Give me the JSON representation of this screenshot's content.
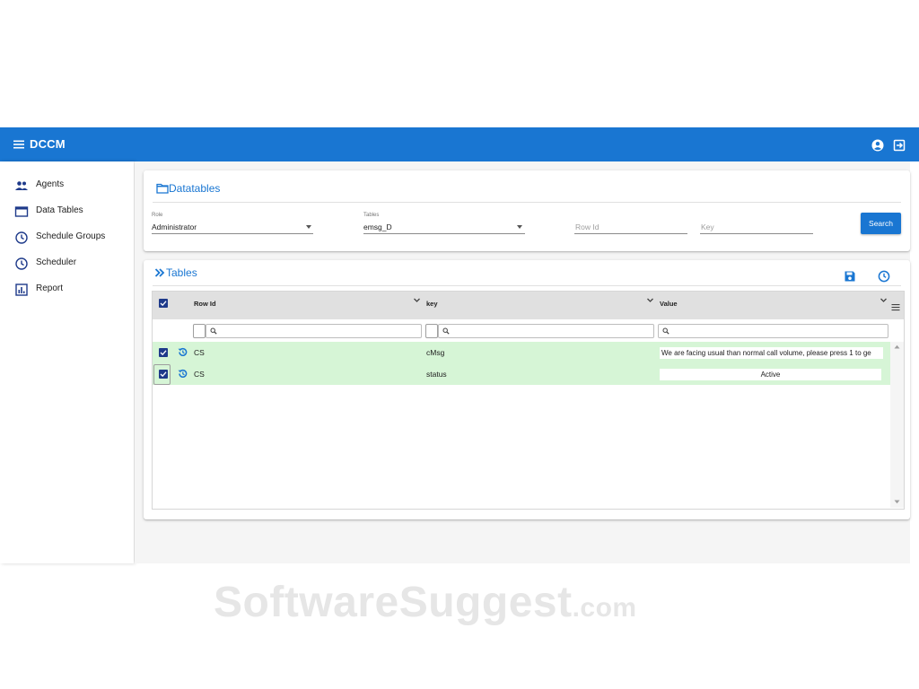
{
  "app": {
    "title": "DCCM",
    "colors": {
      "primary": "#1976d2",
      "row_highlight": "#d6f5d6",
      "checkbox": "#1e3a8a"
    }
  },
  "header": {
    "icons": [
      "menu-icon",
      "account-icon",
      "logout-icon"
    ]
  },
  "sidebar": {
    "items": [
      {
        "label": "Agents",
        "icon": "people-icon"
      },
      {
        "label": "Data Tables",
        "icon": "table-window-icon"
      },
      {
        "label": "Schedule Groups",
        "icon": "clock-icon"
      },
      {
        "label": "Scheduler",
        "icon": "clock-icon"
      },
      {
        "label": "Report",
        "icon": "chart-icon"
      }
    ]
  },
  "datatables_card": {
    "title": "Datatables",
    "icon": "folder-icon",
    "role": {
      "label": "Role",
      "value": "Administrator"
    },
    "tables": {
      "label": "Tables",
      "value": "emsg_D"
    },
    "row_id": {
      "placeholder": "Row Id"
    },
    "key": {
      "placeholder": "Key"
    },
    "search_button": "Search"
  },
  "tables_card": {
    "title": "Tables",
    "icon": "double-chevron-right-icon",
    "actions": [
      "save-icon",
      "history-icon"
    ],
    "columns": [
      "Row Id",
      "key",
      "Value"
    ],
    "rows": [
      {
        "row_id": "CS",
        "key": "cMsg",
        "value": "We are facing usual than normal call volume, please press 1 to ge",
        "checked": true
      },
      {
        "row_id": "CS",
        "key": "status",
        "value": "Active",
        "checked": true
      }
    ]
  },
  "watermark": {
    "main": "SoftwareSuggest",
    "suffix": ".com"
  }
}
